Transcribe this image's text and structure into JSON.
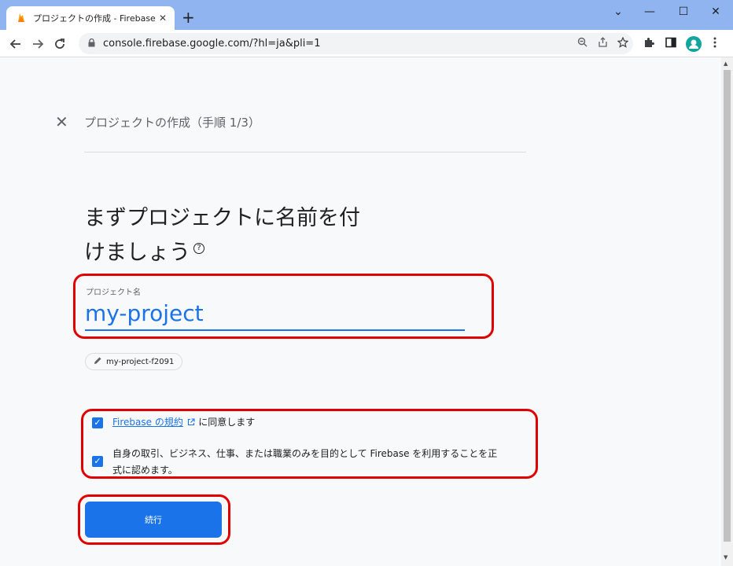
{
  "browser": {
    "tab_title": "プロジェクトの作成 - Firebase コンソール",
    "tab_close": "✕",
    "new_tab": "+",
    "url": "console.firebase.google.com/?hl=ja&pli=1",
    "window_controls": {
      "dropdown": "⌄",
      "minimize": "—",
      "maximize": "☐",
      "close": "✕"
    },
    "icons": [
      "back-icon",
      "forward-icon",
      "reload-icon",
      "lock-icon",
      "zoom-icon",
      "share-icon",
      "star-icon",
      "extensions-icon",
      "sidepanel-icon",
      "profile-avatar",
      "menu-icon"
    ]
  },
  "wizard": {
    "close_icon": "✕",
    "step_title": "プロジェクトの作成（手順 1/3）",
    "heading_line1": "まずプロジェクトに名前を付",
    "heading_line2": "けましょう",
    "help_icon": "?",
    "field_label": "プロジェクト名",
    "field_value": "my-project",
    "project_id": "my-project-f2091",
    "terms_link": "Firebase の規約",
    "terms_suffix": "に同意します",
    "purpose_text_line1": "自身の取引、ビジネス、仕事、または職業のみを目的として Firebase を利用することを正",
    "purpose_text_line2": "式に認めます。",
    "continue_label": "続行"
  },
  "colors": {
    "accent": "#1a73e8",
    "highlight": "#e00000",
    "titlebar": "#8fb4f0"
  }
}
